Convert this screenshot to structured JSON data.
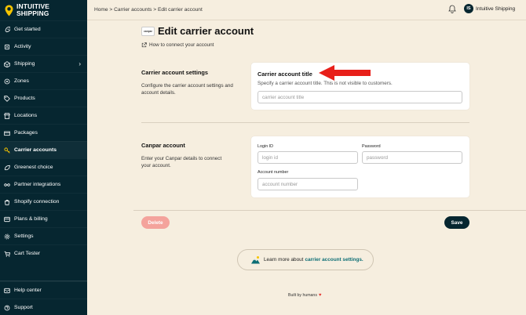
{
  "brand": {
    "line1": "INTUITIVE",
    "line2": "SHIPPING"
  },
  "sidebar": {
    "items": [
      {
        "label": "Get started",
        "icon": "rocket-icon"
      },
      {
        "label": "Activity",
        "icon": "activity-icon"
      },
      {
        "label": "Shipping",
        "icon": "box-icon",
        "expandable": true
      },
      {
        "label": "Zones",
        "icon": "zones-icon"
      },
      {
        "label": "Products",
        "icon": "tag-icon"
      },
      {
        "label": "Locations",
        "icon": "store-icon"
      },
      {
        "label": "Packages",
        "icon": "package-icon"
      },
      {
        "label": "Carrier accounts",
        "icon": "key-icon",
        "active": true
      },
      {
        "label": "Greenest choice",
        "icon": "leaf-icon"
      },
      {
        "label": "Partner integrations",
        "icon": "integration-icon"
      },
      {
        "label": "Shopify connection",
        "icon": "shopify-icon"
      },
      {
        "label": "Plans & billing",
        "icon": "billing-icon"
      },
      {
        "label": "Settings",
        "icon": "gear-icon"
      },
      {
        "label": "Cart Tester",
        "icon": "cart-icon"
      }
    ],
    "bottom": [
      {
        "label": "Help center",
        "icon": "help-icon"
      },
      {
        "label": "Support",
        "icon": "support-icon"
      }
    ]
  },
  "topbar": {
    "breadcrumb": "Home > Carrier accounts > Edit carrier account",
    "user_initials": "IS",
    "user_name": "Intuitive Shipping"
  },
  "page": {
    "carrier_logo_text": "canpar",
    "title": "Edit carrier account",
    "howto_link": "How to connect your account"
  },
  "settings_section": {
    "title": "Carrier account settings",
    "description": "Configure the carrier account settings and account details.",
    "card_title": "Carrier account title",
    "card_sub": "Specify a carrier account title. This is not visible to customers.",
    "title_placeholder": "carrier account title"
  },
  "carrier_section": {
    "title": "Canpar account",
    "description": "Enter your Canpar details to connect your account.",
    "login_label": "Login ID",
    "login_placeholder": "login id",
    "password_label": "Password",
    "password_placeholder": "password",
    "account_label": "Account number",
    "account_placeholder": "account number"
  },
  "actions": {
    "delete_label": "Delete",
    "save_label": "Save"
  },
  "learn_more": {
    "prefix": "Learn more about",
    "link": "carrier account settings."
  },
  "footer": {
    "built_by": "Built by humans"
  },
  "colors": {
    "sidebar_bg": "#062630",
    "page_bg": "#f6eedf",
    "save_bg": "#062630",
    "delete_bg": "#f4a39c",
    "link": "#0d6e75",
    "arrow": "#e8201a"
  }
}
